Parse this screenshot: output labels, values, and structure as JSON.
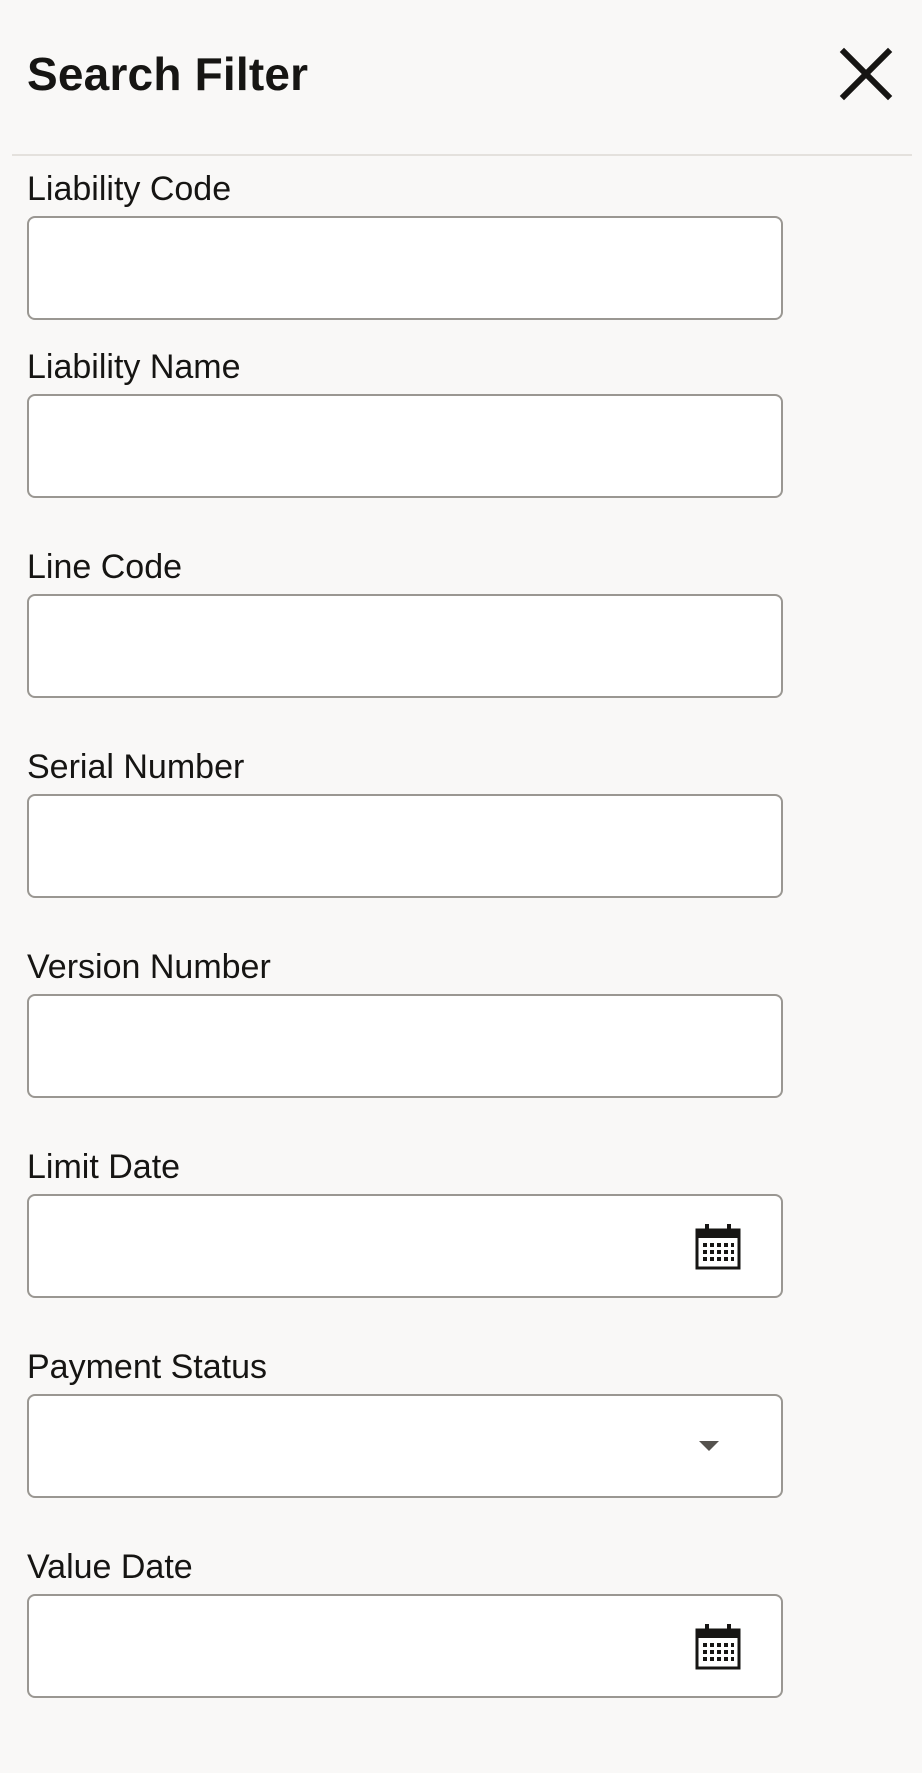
{
  "header": {
    "title": "Search Filter",
    "close_icon": "close-icon"
  },
  "fields": {
    "liability_code": {
      "label": "Liability Code",
      "value": "",
      "placeholder": ""
    },
    "liability_name": {
      "label": "Liability Name",
      "value": "",
      "placeholder": ""
    },
    "line_code": {
      "label": "Line Code",
      "value": "",
      "placeholder": ""
    },
    "serial_number": {
      "label": "Serial Number",
      "value": "",
      "placeholder": ""
    },
    "version_number": {
      "label": "Version Number",
      "value": "",
      "placeholder": ""
    },
    "limit_date": {
      "label": "Limit Date",
      "value": "",
      "placeholder": "",
      "icon": "calendar-icon"
    },
    "payment_status": {
      "label": "Payment Status",
      "value": "",
      "placeholder": "",
      "icon": "chevron-down-icon"
    },
    "value_date": {
      "label": "Value Date",
      "value": "",
      "placeholder": "",
      "icon": "calendar-icon"
    }
  },
  "colors": {
    "panel_background": "#f9f8f7",
    "input_background": "#ffffff",
    "input_border": "#9a9792",
    "text": "#161513",
    "divider": "#e4e1dd"
  }
}
